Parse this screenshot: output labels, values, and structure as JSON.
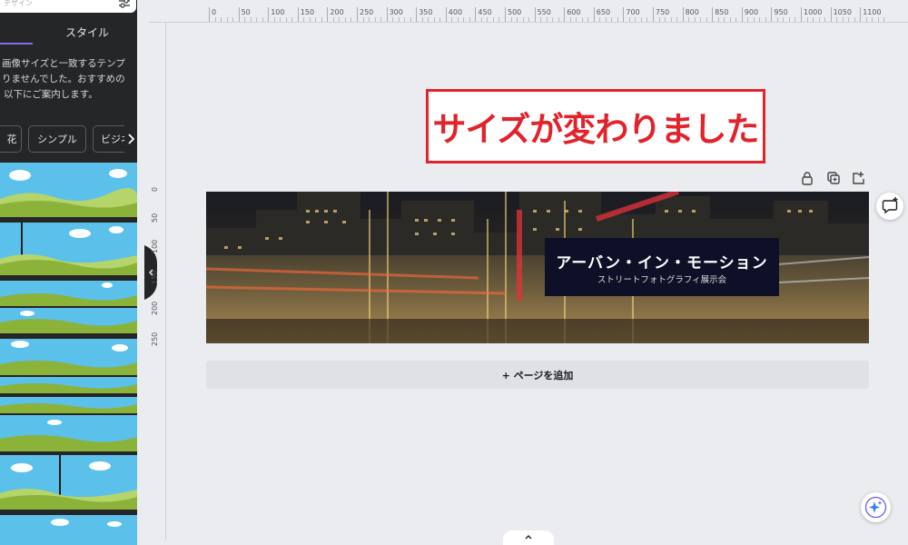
{
  "panel": {
    "search_placeholder": "デザイン",
    "tab_active": "",
    "tab_style": "スタイル",
    "notice_lines": [
      "画像サイズと一致するテンプ",
      "りませんでした。おすすめの",
      "以下にご案内します。"
    ],
    "chips": [
      "花",
      "シンプル",
      "ビジネ"
    ],
    "chip_next": "›"
  },
  "ruler": {
    "top_ticks": [
      "0",
      "50",
      "100",
      "150",
      "200",
      "250",
      "300",
      "350",
      "400",
      "450",
      "500",
      "550",
      "600",
      "650",
      "700",
      "750",
      "800",
      "850",
      "900",
      "950",
      "1000",
      "1050",
      "1100"
    ],
    "left_ticks": [
      "0",
      "50",
      "100",
      "150",
      "200",
      "250"
    ]
  },
  "caption": {
    "text": "サイズが変わりました"
  },
  "banner": {
    "title": "アーバン・イン・モーション",
    "subtitle": "ストリートフォトグラフィ展示会"
  },
  "add_page": {
    "label": "+ ページを追加"
  },
  "colors": {
    "panel_bg": "#252627",
    "canvas_bg": "#ebecf0",
    "accent": "#8b6cf0",
    "caption_red": "#e2232b",
    "title_box": "#0d1026",
    "sky": "#5bc0ea",
    "grass": "#8bb33a"
  },
  "icons": {
    "filter": "filter-icon",
    "lock": "lock-icon",
    "duplicate": "duplicate-icon",
    "share": "share-icon",
    "comment": "comment-add-icon",
    "magic": "magic-sparkle-icon",
    "collapse": "chevron-left-icon",
    "expand": "chevron-up-icon"
  }
}
